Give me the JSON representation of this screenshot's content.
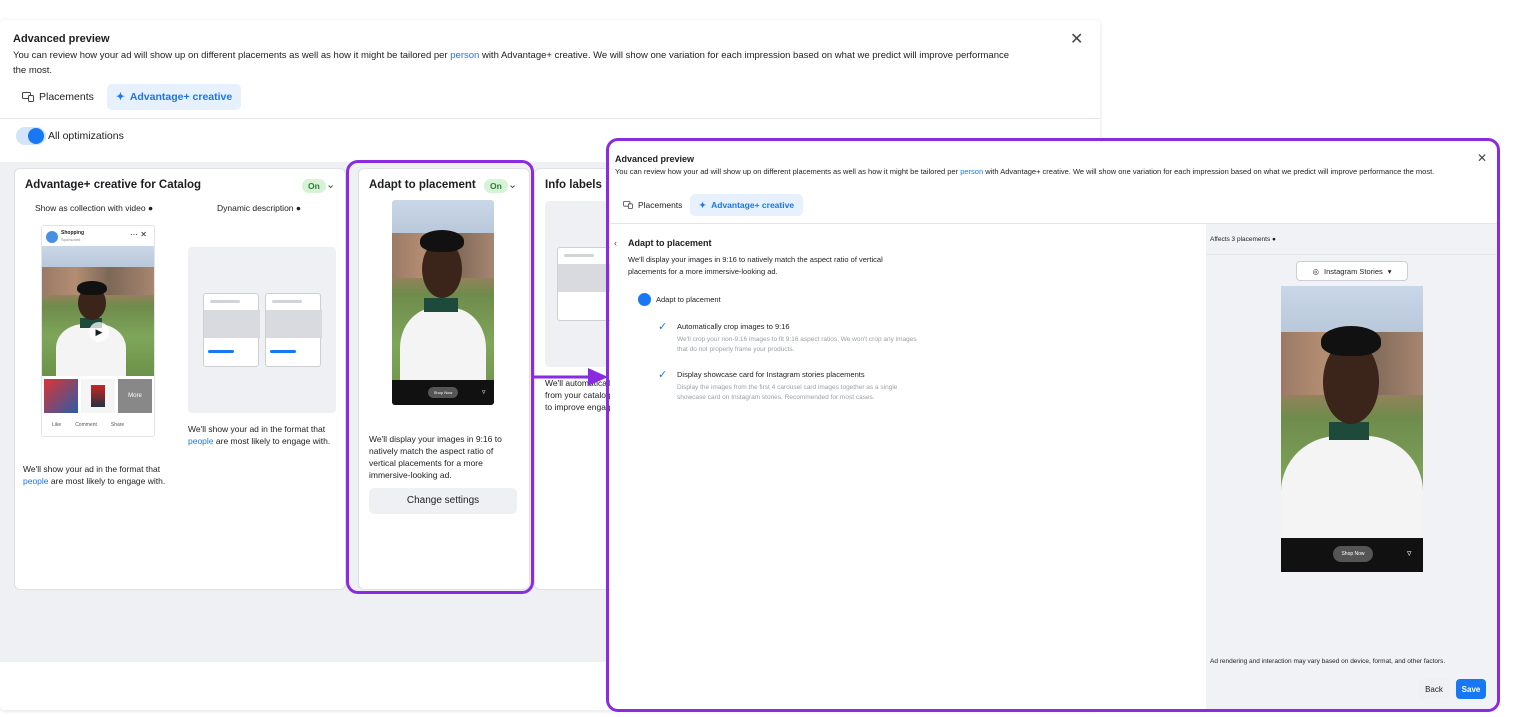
{
  "bg": {
    "title": "Advanced preview",
    "desc_part1": "You can review how your ad will show up on different placements as well as how it might be tailored per ",
    "desc_link": "person",
    "desc_part2": " with Advantage+ creative. We will show one variation for each impression based on what we predict will improve performance the most.",
    "tabs": [
      {
        "label": "Placements",
        "icon": "placements-icon"
      },
      {
        "label": "Advantage+ creative",
        "icon": "sparkle-icon",
        "active": true
      }
    ],
    "toggle_label": "All optimizations",
    "catalog_card": {
      "title": "Advantage+ creative for Catalog",
      "badge": "On",
      "col1_label": "Show as collection with video",
      "col2_label": "Dynamic description",
      "sponsor_name": "Shopping",
      "sponsor_sub": "Sponsored",
      "col1_desc_part1": "We'll show your ad in the format that ",
      "col1_desc_link": "people",
      "col1_desc_part2": " are most likely to engage with.",
      "col2_desc_part1": "We'll show your ad in the format that ",
      "col2_desc_link": "people",
      "col2_desc_part2": " are most likely to engage with.",
      "reactions": [
        "Like",
        "Comment",
        "Share"
      ],
      "more_tile": "More"
    },
    "placement_card": {
      "title": "Adapt to placement",
      "badge": "On",
      "cta": "Shop Now",
      "desc": "We'll display your images in 9:16 to natively match the aspect ratio of vertical placements for a more immersive-looking ad.",
      "button": "Change settings"
    },
    "info_card": {
      "title": "Info labels",
      "desc": "We'll automatically show relevant info from your catalog on ads when it's likely to improve engagement."
    }
  },
  "fg": {
    "title": "Advanced preview",
    "desc_part1": "You can review how your ad will show up on different placements as well as how it might be tailored per ",
    "desc_link": "person",
    "desc_part2": " with Advantage+ creative. We will show one variation for each impression based on what we predict will improve performance the most.",
    "tabs": [
      {
        "label": "Placements"
      },
      {
        "label": "Advantage+ creative",
        "active": true
      }
    ],
    "section_title": "Adapt to placement",
    "section_desc": "We'll display your images in 9:16 to natively match the aspect ratio of vertical placements for a more immersive-looking ad.",
    "radio_label": "Adapt to placement",
    "options": [
      {
        "label": "Automatically crop images to 9:16",
        "sub": "We'll crop your non-9:16 images to fit 9:16 aspect ratios. We won't crop any images that do not properly frame your products.",
        "checked": true
      },
      {
        "label": "Display showcase card for Instagram stories placements",
        "sub": "Display the images from the first 4 carousel card images together as a single showcase card on Instagram stories. Recommended for most cases.",
        "checked": true
      }
    ],
    "affects": "Affects 3 placements",
    "placement_select": "Instagram Stories",
    "cta": "Shop Now",
    "footnote": "Ad rendering and interaction may vary based on device, format, and other factors.",
    "back": "Back",
    "save": "Save"
  },
  "colors": {
    "accent": "#1877f2",
    "highlight_frame": "#8a2be2",
    "on_badge": "#2e7d32"
  }
}
